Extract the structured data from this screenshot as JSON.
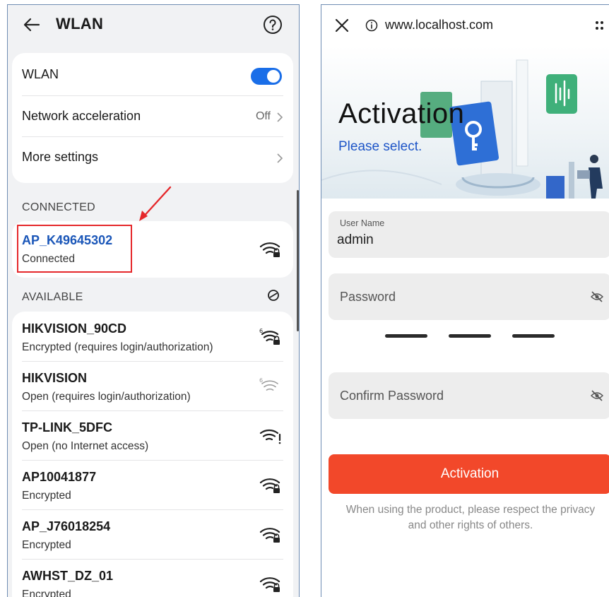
{
  "wlan": {
    "title": "WLAN",
    "settings": [
      {
        "label": "WLAN",
        "toggle_on": true
      },
      {
        "label": "Network acceleration",
        "value": "Off"
      },
      {
        "label": "More settings"
      }
    ],
    "connected_label": "CONNECTED",
    "connected_network": {
      "name": "AP_K49645302",
      "status": "Connected",
      "icon": "wifi-locked-icon"
    },
    "available_label": "AVAILABLE",
    "available_networks": [
      {
        "name": "HIKVISION_90CD",
        "status": "Encrypted (requires login/authorization)",
        "icon": "wifi6-locked-icon"
      },
      {
        "name": "HIKVISION",
        "status": "Open (requires login/authorization)",
        "icon": "wifi6-weak-icon"
      },
      {
        "name": "TP-LINK_5DFC",
        "status": "Open (no Internet access)",
        "icon": "wifi-no-internet-icon"
      },
      {
        "name": "AP10041877",
        "status": "Encrypted",
        "icon": "wifi-locked-icon"
      },
      {
        "name": "AP_J76018254",
        "status": "Encrypted",
        "icon": "wifi-locked-icon"
      },
      {
        "name": "AWHST_DZ_01",
        "status": "Encrypted",
        "icon": "wifi-locked-icon"
      }
    ],
    "colors": {
      "accent": "#1a6ee8",
      "connected_name": "#1a56b8",
      "highlight": "#e5282b"
    }
  },
  "browser": {
    "url": "www.localhost.com",
    "hero_title": "Activation",
    "hero_subtitle": "Please select.",
    "username_label": "User Name",
    "username_value": "admin",
    "password_placeholder": "Password",
    "confirm_password_placeholder": "Confirm Password",
    "activate_label": "Activation",
    "privacy_line1": "When using the product, please respect the privacy",
    "privacy_line2": "and other rights of others.",
    "colors": {
      "button": "#f2482a",
      "subtitle": "#1e55c8"
    }
  }
}
